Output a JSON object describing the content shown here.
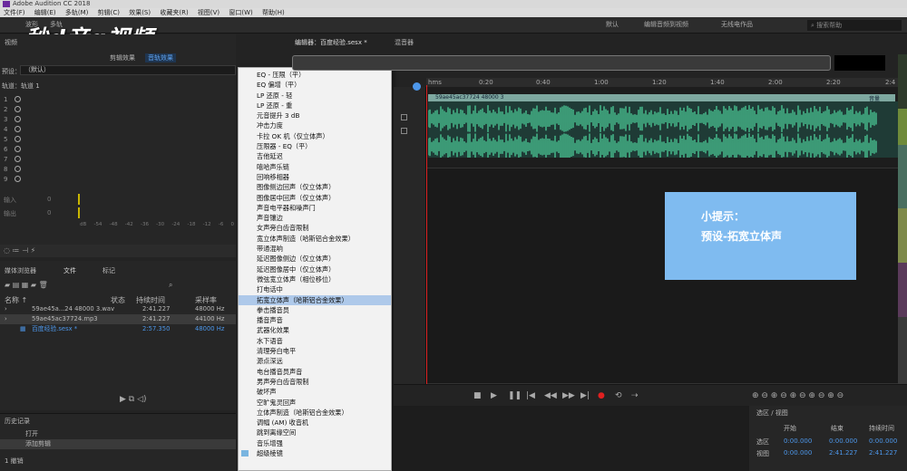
{
  "window": {
    "title": "Adobe Audition CC 2018"
  },
  "menubar": [
    "文件(F)",
    "编辑(E)",
    "多轨(M)",
    "剪辑(C)",
    "效果(S)",
    "收藏夹(R)",
    "视图(V)",
    "窗口(W)",
    "帮助(H)"
  ],
  "toolbar": {
    "waveform": "波形",
    "multitrack": "多轨",
    "workspaces": [
      "默认",
      "编辑音频到视频",
      "无线电作品"
    ],
    "search_placeholder": "搜索帮助"
  },
  "logo": "秒d音g视频",
  "left": {
    "panel_tab": "视频",
    "subtabs": [
      "剪辑效果",
      "音轨效果"
    ],
    "preset_label": "预设：",
    "preset_value": "（默认）",
    "track_label": "轨道：轨道 1",
    "slots": [
      "1",
      "2",
      "3",
      "4",
      "5",
      "6",
      "7",
      "8",
      "9"
    ],
    "input_label": "输入",
    "output_label": "输出",
    "zero": "0",
    "scale": [
      "dB",
      "-54",
      "-48",
      "-42",
      "-36",
      "-30",
      "-24",
      "-18",
      "-12",
      "-6",
      "0"
    ]
  },
  "menu": {
    "items": [
      "EQ - 压限（平）",
      "EQ 偏增（平）",
      "LP 还原 - 轻",
      "LP 还原 - 重",
      "元音提升 3 dB",
      "冲击力度",
      "卡拉 OK 机（仅立体声）",
      "压限器 - EQ（平）",
      "吉他延迟",
      "嘻哈声乐链",
      "回响移相器",
      "图像侧边回声（仅立体声）",
      "图像居中回声（仅立体声）",
      "声音电平器和噪声门",
      "声音镶边",
      "女声旁白齿音限制",
      "宽立体声制造（哈斯铝合金效果）",
      "带通混响",
      "延迟图像侧边（仅立体声）",
      "延迟图像居中（仅立体声）",
      "微弦宽立体声（相位移位）",
      "打电话中",
      "拓宽立体声（哈斯铝合金效果）",
      "拳击播音员",
      "播音声音",
      "武器化效果",
      "水下语音",
      "清理旁白电平",
      "源点深远",
      "电台播音员声音",
      "男声旁白齿音限制",
      "破坏声",
      "空旷鬼灵回声",
      "立体声制造（哈斯铝合金效果）",
      "调幅 (AM) 收音机",
      "跳到离缘空间",
      "音乐增强",
      "超级棱镜"
    ],
    "selected_index": 22,
    "checked_index": 37
  },
  "files": {
    "tabs": [
      "媒体浏览器",
      "文件",
      "标记"
    ],
    "headers": {
      "name": "名称 ↑",
      "status": "状态",
      "duration": "持续时间",
      "rate": "采样率"
    },
    "rows": [
      {
        "name": "59ae45a...24 48000 3.wav",
        "duration": "2:41.227",
        "rate": "48000 Hz"
      },
      {
        "name": "59ae45ac37724.mp3",
        "duration": "2:41.227",
        "rate": "44100 Hz"
      },
      {
        "name": "百度经验.sesx *",
        "duration": "2:57.350",
        "rate": "48000 Hz"
      }
    ]
  },
  "history": {
    "title": "历史记录",
    "items": [
      "打开",
      "添加剪辑"
    ],
    "undo": "1 撤销"
  },
  "editor": {
    "tab": "编辑器：百度经验.sesx *",
    "mixer": "混音器",
    "ruler": [
      "hms",
      "0:20",
      "0:40",
      "1:00",
      "1:20",
      "1:40",
      "2:00",
      "2:20",
      "2:4"
    ],
    "clip_name": "59ae45ac37724 48000 3",
    "fx_label": "音量"
  },
  "tip": {
    "title": "小提示：",
    "text": "预设-拓宽立体声"
  },
  "selview": {
    "title": "选区 / 视图",
    "cols": [
      "开始",
      "结束",
      "持续时间"
    ],
    "rows": [
      {
        "label": "选区",
        "start": "0:00.000",
        "end": "0:00.000",
        "dur": "0:00.000"
      },
      {
        "label": "视图",
        "start": "0:00.000",
        "end": "2:41.227",
        "dur": "2:41.227"
      }
    ]
  }
}
